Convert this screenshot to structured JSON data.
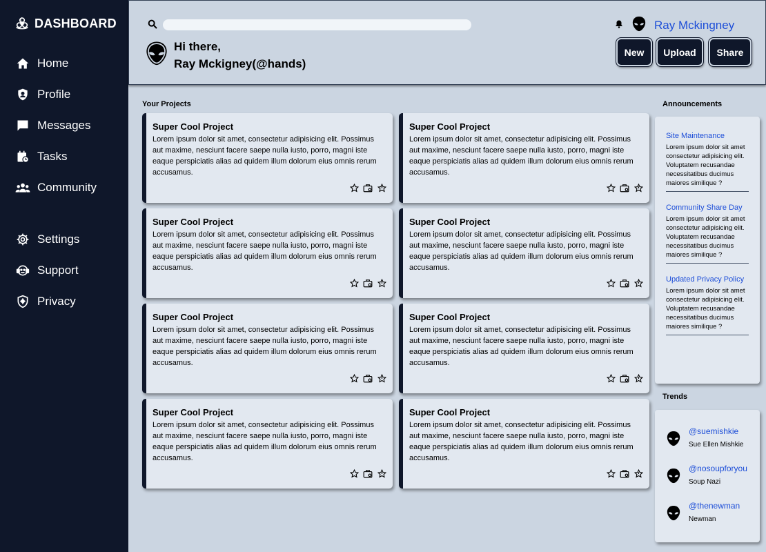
{
  "sidebar": {
    "brand": "DASHBOARD",
    "brand_icon": "biohazard-icon",
    "main_items": [
      {
        "label": "Home",
        "icon": "home-icon"
      },
      {
        "label": "Profile",
        "icon": "user-shield-icon"
      },
      {
        "label": "Messages",
        "icon": "message-icon"
      },
      {
        "label": "Tasks",
        "icon": "calendar-clock-icon"
      },
      {
        "label": "Community",
        "icon": "users-icon"
      }
    ],
    "secondary_items": [
      {
        "label": "Settings",
        "icon": "gear-icon"
      },
      {
        "label": "Support",
        "icon": "headset-icon"
      },
      {
        "label": "Privacy",
        "icon": "shield-virus-icon"
      }
    ]
  },
  "header": {
    "search_placeholder": "",
    "search_value": "",
    "greeting_line1": "Hi there,",
    "greeting_line2": "Ray Mckigney(@hands)",
    "user_name": "Ray Mckingney",
    "buttons": {
      "new": "New",
      "upload": "Upload",
      "share": "Share"
    }
  },
  "projects": {
    "title": "Your Projects",
    "cards": [
      {
        "title": "Super Cool Project",
        "body": "Lorem ipsum dolor sit amet, consectetur adipisicing elit. Possimus aut maxime, nesciunt facere saepe nulla iusto, porro, magni iste eaque perspiciatis alias ad quidem illum dolorum eius omnis rerum accusamus."
      },
      {
        "title": "Super Cool Project",
        "body": "Lorem ipsum dolor sit amet, consectetur adipisicing elit. Possimus aut maxime, nesciunt facere saepe nulla iusto, porro, magni iste eaque perspiciatis alias ad quidem illum dolorum eius omnis rerum accusamus."
      },
      {
        "title": "Super Cool Project",
        "body": "Lorem ipsum dolor sit amet, consectetur adipisicing elit. Possimus aut maxime, nesciunt facere saepe nulla iusto, porro, magni iste eaque perspiciatis alias ad quidem illum dolorum eius omnis rerum accusamus."
      },
      {
        "title": "Super Cool Project",
        "body": "Lorem ipsum dolor sit amet, consectetur adipisicing elit. Possimus aut maxime, nesciunt facere saepe nulla iusto, porro, magni iste eaque perspiciatis alias ad quidem illum dolorum eius omnis rerum accusamus."
      },
      {
        "title": "Super Cool Project",
        "body": "Lorem ipsum dolor sit amet, consectetur adipisicing elit. Possimus aut maxime, nesciunt facere saepe nulla iusto, porro, magni iste eaque perspiciatis alias ad quidem illum dolorum eius omnis rerum accusamus."
      },
      {
        "title": "Super Cool Project",
        "body": "Lorem ipsum dolor sit amet, consectetur adipisicing elit. Possimus aut maxime, nesciunt facere saepe nulla iusto, porro, magni iste eaque perspiciatis alias ad quidem illum dolorum eius omnis rerum accusamus."
      },
      {
        "title": "Super Cool Project",
        "body": "Lorem ipsum dolor sit amet, consectetur adipisicing elit. Possimus aut maxime, nesciunt facere saepe nulla iusto, porro, magni iste eaque perspiciatis alias ad quidem illum dolorum eius omnis rerum accusamus."
      },
      {
        "title": "Super Cool Project",
        "body": "Lorem ipsum dolor sit amet, consectetur adipisicing elit. Possimus aut maxime, nesciunt facere saepe nulla iusto, porro, magni iste eaque perspiciatis alias ad quidem illum dolorum eius omnis rerum accusamus."
      }
    ],
    "card_action_icons": [
      "star-plus-icon",
      "briefcase-eye-icon",
      "star-share-icon"
    ]
  },
  "announcements": {
    "title": "Announcements",
    "items": [
      {
        "title": "Site Maintenance",
        "body": "Lorem ipsum dolor sit amet consectetur adipisicing elit. Voluptatem recusandae necessitatibus ducimus maiores similique ?"
      },
      {
        "title": "Community Share Day",
        "body": "Lorem ipsum dolor sit amet consectetur adipisicing elit. Voluptatem recusandae necessitatibus ducimus maiores similique ?"
      },
      {
        "title": "Updated Privacy Policy",
        "body": "Lorem ipsum dolor sit amet consectetur adipisicing elit. Voluptatem recusandae necessitatibus ducimus maiores similique ?"
      }
    ]
  },
  "trends": {
    "title": "Trends",
    "items": [
      {
        "handle": "@suemishkie",
        "name": "Sue Ellen Mishkie"
      },
      {
        "handle": "@nosoupforyou",
        "name": "Soup Nazi"
      },
      {
        "handle": "@thenewman",
        "name": "Newman"
      }
    ]
  },
  "colors": {
    "sidebar_bg": "#0f172a",
    "page_bg": "#cbd5e1",
    "card_bg": "#e2e8f0",
    "link": "#1d4ed8"
  }
}
